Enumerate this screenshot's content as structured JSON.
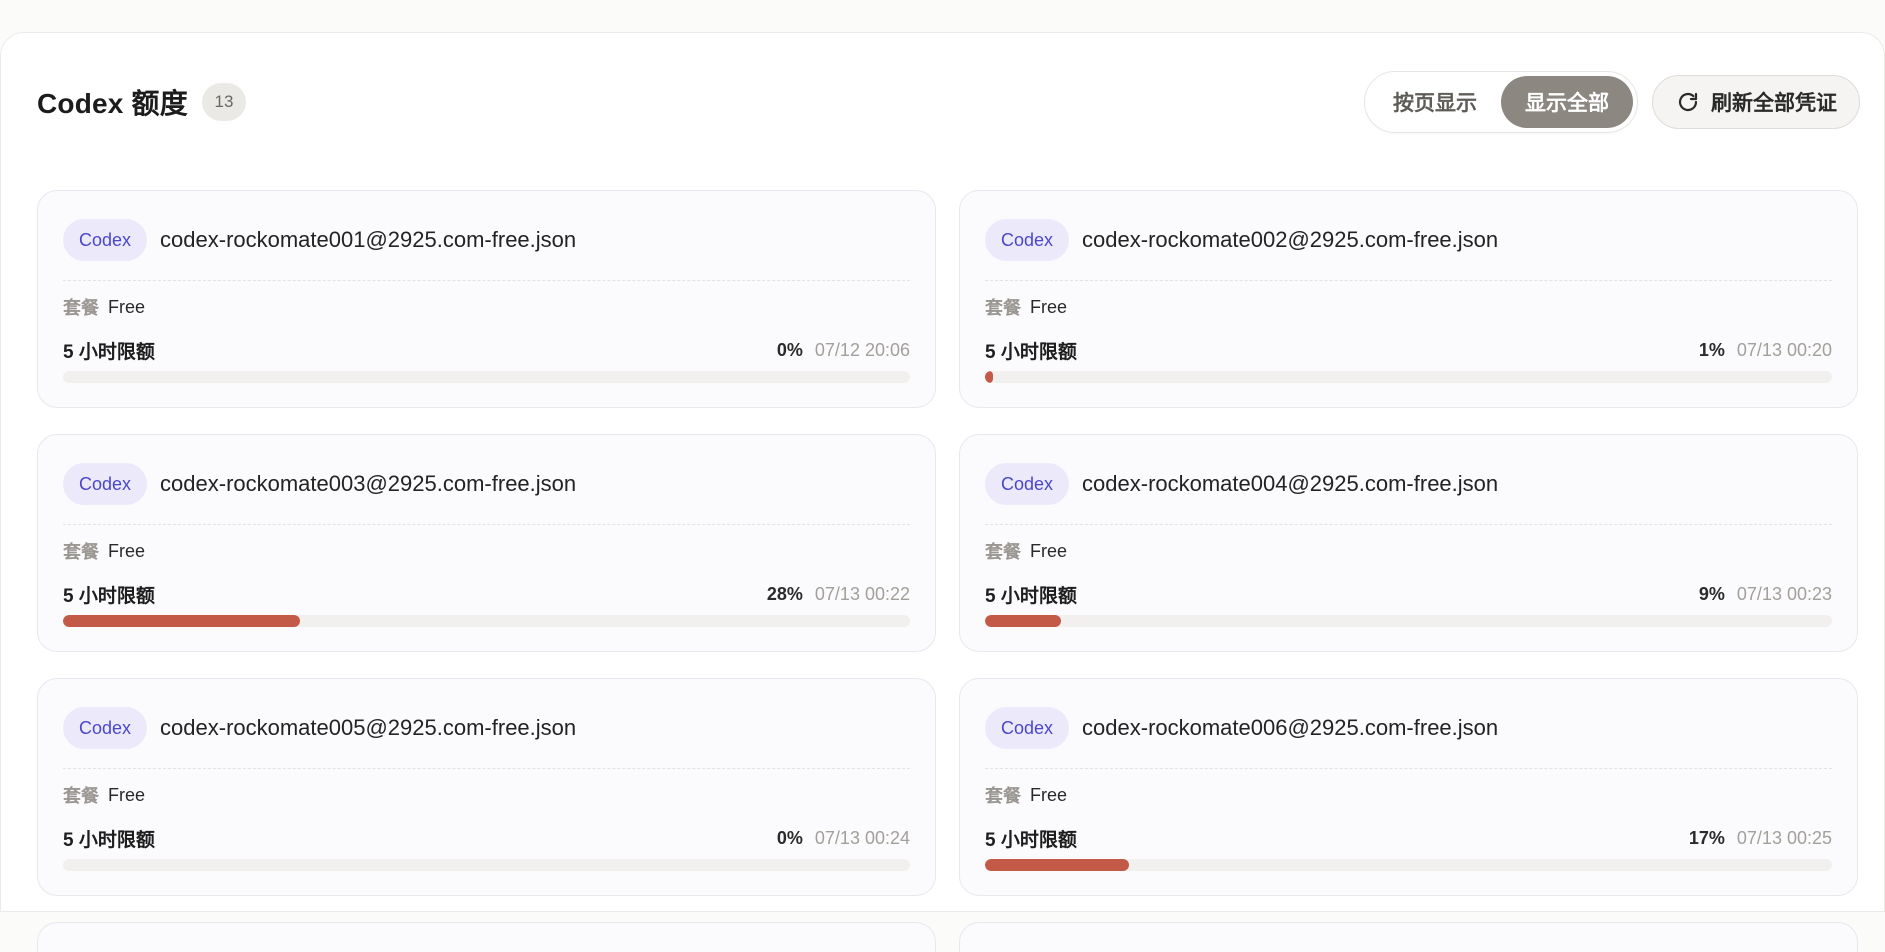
{
  "header": {
    "title": "Codex 额度",
    "count": "13",
    "view_paged": "按页显示",
    "view_all": "显示全部",
    "refresh_all": "刷新全部凭证"
  },
  "colors": {
    "accent_bar": "#c25a47",
    "badge_text": "#4b47c9",
    "active_segment": "#8c8781"
  },
  "cards": [
    {
      "type": "Codex",
      "file": "codex-rockomate001@2925.com-free.json",
      "plan_label": "套餐",
      "plan": "Free",
      "quota_label": "5 小时限额",
      "percent": "0%",
      "usage": 0,
      "reset": "07/12 20:06"
    },
    {
      "type": "Codex",
      "file": "codex-rockomate002@2925.com-free.json",
      "plan_label": "套餐",
      "plan": "Free",
      "quota_label": "5 小时限额",
      "percent": "1%",
      "usage": 1,
      "reset": "07/13 00:20"
    },
    {
      "type": "Codex",
      "file": "codex-rockomate003@2925.com-free.json",
      "plan_label": "套餐",
      "plan": "Free",
      "quota_label": "5 小时限额",
      "percent": "28%",
      "usage": 28,
      "reset": "07/13 00:22"
    },
    {
      "type": "Codex",
      "file": "codex-rockomate004@2925.com-free.json",
      "plan_label": "套餐",
      "plan": "Free",
      "quota_label": "5 小时限额",
      "percent": "9%",
      "usage": 9,
      "reset": "07/13 00:23"
    },
    {
      "type": "Codex",
      "file": "codex-rockomate005@2925.com-free.json",
      "plan_label": "套餐",
      "plan": "Free",
      "quota_label": "5 小时限额",
      "percent": "0%",
      "usage": 0,
      "reset": "07/13 00:24"
    },
    {
      "type": "Codex",
      "file": "codex-rockomate006@2925.com-free.json",
      "plan_label": "套餐",
      "plan": "Free",
      "quota_label": "5 小时限额",
      "percent": "17%",
      "usage": 17,
      "reset": "07/13 00:25"
    }
  ]
}
